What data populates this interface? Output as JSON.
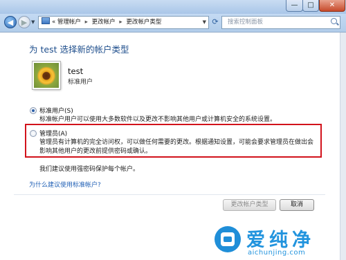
{
  "window_controls": {
    "minimize": "—",
    "maximize": "□",
    "close": "✕"
  },
  "toolbar": {
    "back_glyph": "◀",
    "forward_glyph": "▶",
    "breadcrumb_prefix": "«",
    "breadcrumb": [
      "管理帐户",
      "更改帐户",
      "更改帐户类型"
    ],
    "separator": "▸",
    "search_placeholder": "搜索控制面板"
  },
  "page": {
    "title": "为 test 选择新的帐户类型",
    "user": {
      "name": "test",
      "type": "标准用户"
    },
    "options": [
      {
        "label": "标准用户(S)",
        "selected": true,
        "desc": "标准帐户用户可以使用大多数软件以及更改不影响其他用户或计算机安全的系统设置。"
      },
      {
        "label": "管理员(A)",
        "selected": false,
        "desc": "管理员有计算机的完全访问权，可以做任何需要的更改。根据通知设置，可能会要求管理员在做出会影响其他用户的更改前提供密码或确认。"
      }
    ],
    "tip": "我们建议使用强密码保护每个帐户。",
    "why_link": "为什么建议使用标准帐户?",
    "buttons": {
      "change": "更改帐户类型",
      "cancel": "取消"
    }
  },
  "watermark": {
    "title": "爱纯净",
    "url": "aichunjing.com"
  },
  "colors": {
    "highlight_box": "#d2121b",
    "link": "#1f5fb5",
    "title": "#1e4e8c",
    "watermark": "#2294de"
  }
}
